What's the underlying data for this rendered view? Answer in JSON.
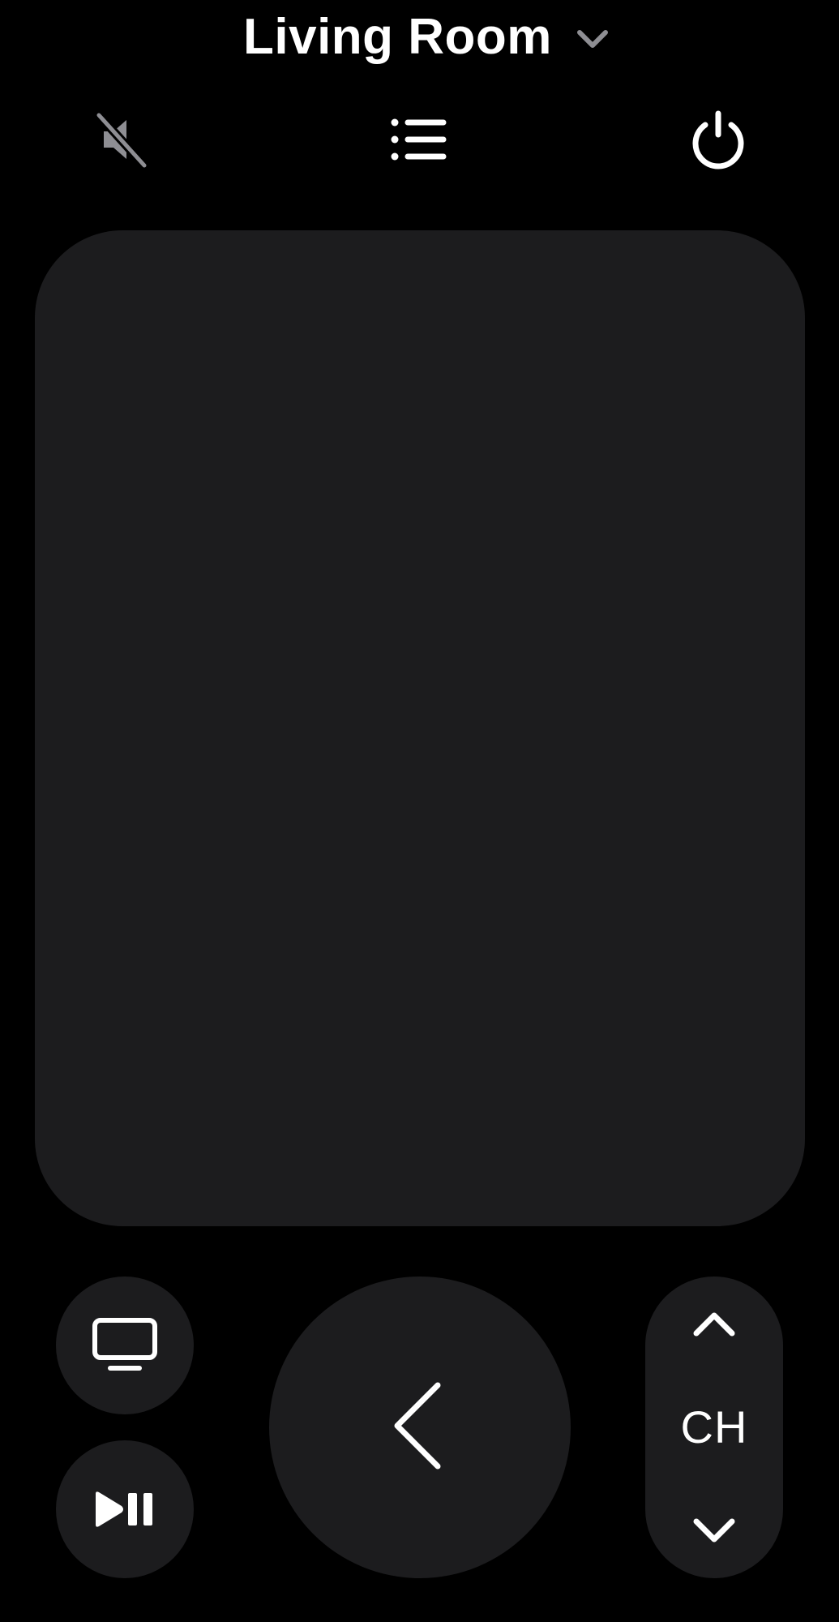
{
  "header": {
    "device_name": "Living Room",
    "picker_icon": "chevron-down-icon"
  },
  "top_controls": {
    "mute_icon": "speaker-slash-icon",
    "menu_icon": "list-icon",
    "power_icon": "power-icon"
  },
  "bottom_controls": {
    "tv_icon": "tv-icon",
    "play_pause_icon": "play-pause-icon",
    "back_icon": "chevron-left-icon",
    "channel_label": "CH",
    "channel_up_icon": "chevron-up-icon",
    "channel_down_icon": "chevron-down-icon"
  },
  "colors": {
    "background": "#000000",
    "surface": "#1c1c1e",
    "foreground": "#ffffff",
    "muted": "#8e8e93"
  }
}
